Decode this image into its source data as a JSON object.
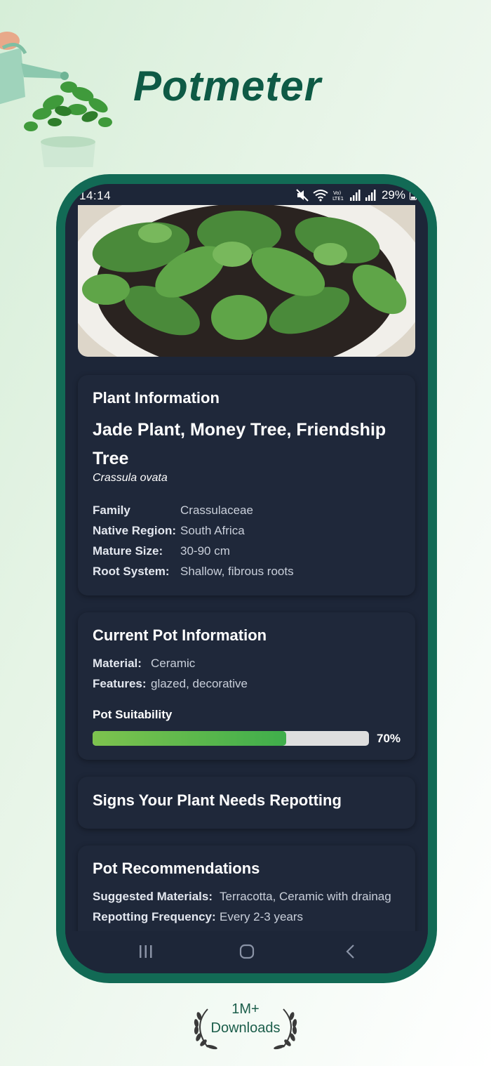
{
  "app": {
    "title": "Potmeter"
  },
  "status_bar": {
    "time": "14:14",
    "battery": "29%"
  },
  "plant_info": {
    "heading": "Plant Information",
    "common_names": "Jade Plant, Money Tree, Friendship Tree",
    "scientific_name": "Crassula ovata",
    "rows": [
      {
        "label": "Family",
        "value": "Crassulaceae"
      },
      {
        "label": "Native Region:",
        "value": "South Africa"
      },
      {
        "label": "Mature Size:",
        "value": "30-90 cm"
      },
      {
        "label": "Root System:",
        "value": "Shallow, fibrous roots"
      }
    ]
  },
  "pot_info": {
    "heading": "Current Pot Information",
    "rows": [
      {
        "label": "Material:",
        "value": "Ceramic"
      },
      {
        "label": "Features:",
        "value": "glazed, decorative"
      }
    ],
    "suitability_label": "Pot Suitability",
    "suitability_value": 70,
    "suitability_text": "70%"
  },
  "repotting_signs": {
    "heading": "Signs Your Plant Needs Repotting"
  },
  "recommendations": {
    "heading": "Pot Recommendations",
    "rows": [
      {
        "label": "Suggested Materials:",
        "value": "Terracotta, Ceramic with drainag"
      },
      {
        "label": "Repotting Frequency:",
        "value": "Every 2-3 years"
      }
    ]
  },
  "footer": {
    "downloads_count": "1M+",
    "downloads_label": "Downloads"
  },
  "colors": {
    "brand": "#0e5a45",
    "phone_frame": "#126a55",
    "screen_bg": "#1d2638",
    "progress_fill": "#3fae4b"
  }
}
